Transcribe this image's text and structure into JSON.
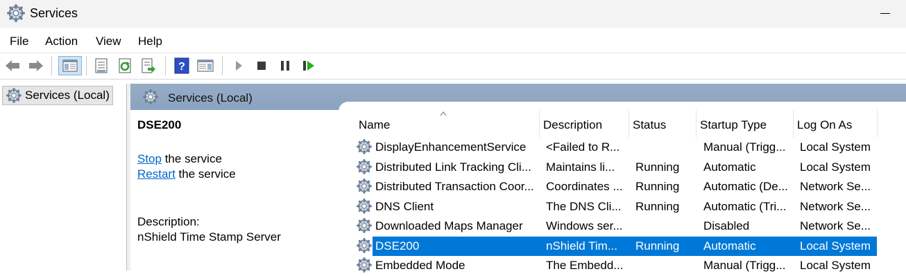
{
  "window": {
    "title": "Services",
    "app_icon": "services-gear-icon"
  },
  "menu": [
    "File",
    "Action",
    "View",
    "Help"
  ],
  "toolbar": {
    "icons": [
      "back-arrow-icon",
      "forward-arrow-icon",
      "show-hide-console-tree-icon",
      "properties-icon",
      "refresh-icon",
      "export-list-icon",
      "help-icon",
      "show-action-pane-icon",
      "start-service-icon",
      "stop-service-icon",
      "pause-service-icon",
      "restart-service-icon"
    ]
  },
  "tree": {
    "root": "Services (Local)"
  },
  "pane_header": "Services (Local)",
  "extended": {
    "service_name": "DSE200",
    "stop_link": "Stop",
    "stop_suffix": " the service",
    "restart_link": "Restart",
    "restart_suffix": " the service",
    "description_label": "Description:",
    "description_text": "nShield Time Stamp Server"
  },
  "columns": [
    "Name",
    "Description",
    "Status",
    "Startup Type",
    "Log On As"
  ],
  "rows": [
    {
      "name": "DisplayEnhancementService",
      "description": "<Failed to R...",
      "status": "",
      "startup": "Manual (Trigg...",
      "logon": "Local System"
    },
    {
      "name": "Distributed Link Tracking Cli...",
      "description": "Maintains li...",
      "status": "Running",
      "startup": "Automatic",
      "logon": "Local System"
    },
    {
      "name": "Distributed Transaction Coor...",
      "description": "Coordinates ...",
      "status": "Running",
      "startup": "Automatic (De...",
      "logon": "Network Se..."
    },
    {
      "name": "DNS Client",
      "description": "The DNS Cli...",
      "status": "Running",
      "startup": "Automatic (Tri...",
      "logon": "Network Se..."
    },
    {
      "name": "Downloaded Maps Manager",
      "description": "Windows ser...",
      "status": "",
      "startup": "Disabled",
      "logon": "Network Se..."
    },
    {
      "name": "DSE200",
      "description": "nShield Tim...",
      "status": "Running",
      "startup": "Automatic",
      "logon": "Local System"
    },
    {
      "name": "Embedded Mode",
      "description": "The Embedd...",
      "status": "",
      "startup": "Manual (Trigg...",
      "logon": "Local System"
    }
  ],
  "selected_row": 5,
  "colors": {
    "selection": "#0078d7",
    "link": "#0066cc",
    "header": "#8fa7c4"
  }
}
